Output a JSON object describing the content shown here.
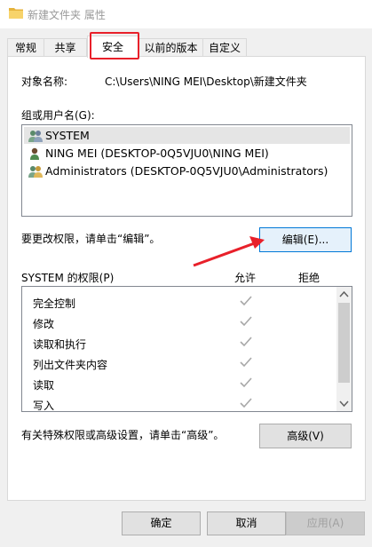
{
  "window": {
    "title": "新建文件夹 属性"
  },
  "tabs": [
    {
      "label": "常规"
    },
    {
      "label": "共享"
    },
    {
      "label": "安全",
      "active": true
    },
    {
      "label": "以前的版本"
    },
    {
      "label": "自定义"
    }
  ],
  "security": {
    "object_name_label": "对象名称:",
    "object_name_value": "C:\\Users\\NING MEI\\Desktop\\新建文件夹",
    "groups_label": "组或用户名(G):",
    "users": [
      {
        "name": "SYSTEM",
        "icon": "users-group-icon",
        "selected": true
      },
      {
        "name": "NING MEI (DESKTOP-0Q5VJU0\\NING MEI)",
        "icon": "user-icon"
      },
      {
        "name": "Administrators (DESKTOP-0Q5VJU0\\Administrators)",
        "icon": "users-group-icon"
      }
    ],
    "edit_hint": "要更改权限，请单击“编辑”。",
    "edit_button": "编辑(E)...",
    "permissions_label": "SYSTEM 的权限(P)",
    "allow_header": "允许",
    "deny_header": "拒绝",
    "permissions": [
      {
        "name": "完全控制",
        "allow": true,
        "deny": false
      },
      {
        "name": "修改",
        "allow": true,
        "deny": false
      },
      {
        "name": "读取和执行",
        "allow": true,
        "deny": false
      },
      {
        "name": "列出文件夹内容",
        "allow": true,
        "deny": false
      },
      {
        "name": "读取",
        "allow": true,
        "deny": false
      },
      {
        "name": "写入",
        "allow": true,
        "deny": false
      }
    ],
    "advanced_hint": "有关特殊权限或高级设置，请单击“高级”。",
    "advanced_button": "高级(V)"
  },
  "footer": {
    "ok": "确定",
    "cancel": "取消",
    "apply": "应用(A)"
  },
  "colors": {
    "highlight_red": "#e8202a",
    "check_gray": "#a8a8a8",
    "folder_yellow": "#f0c040"
  }
}
